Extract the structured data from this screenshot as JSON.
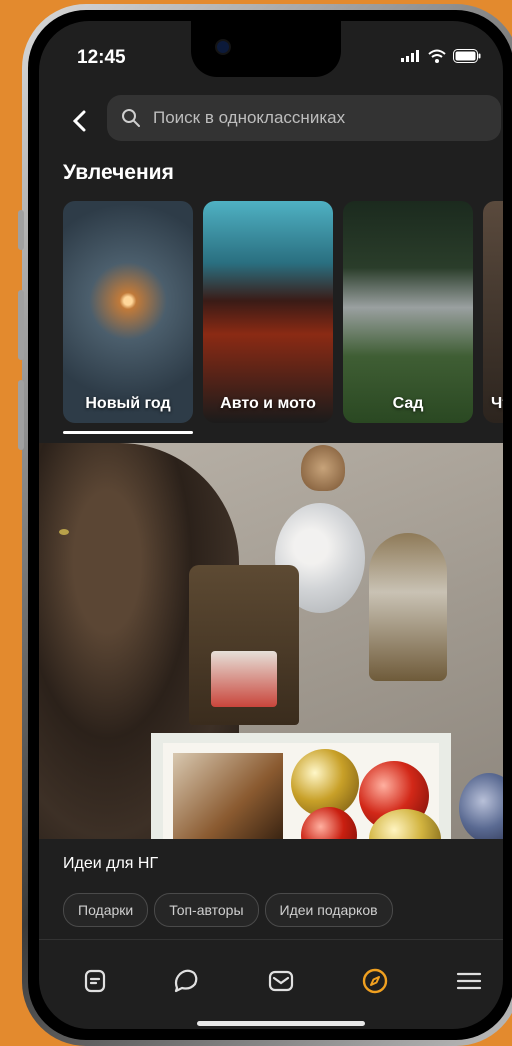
{
  "status": {
    "time": "12:45"
  },
  "search": {
    "placeholder": "Поиск в одноклассниках"
  },
  "section": {
    "title": "Увлечения"
  },
  "categories": [
    {
      "label": "Новый год",
      "selected": true
    },
    {
      "label": "Авто и мото",
      "selected": false
    },
    {
      "label": "Сад",
      "selected": false
    },
    {
      "label": "Чт",
      "selected": false
    }
  ],
  "post": {
    "title": "Идеи для НГ"
  },
  "chips": [
    "Подарки",
    "Топ-авторы",
    "Идеи подарков"
  ],
  "tabbar": {
    "items": [
      {
        "icon": "feed-icon"
      },
      {
        "icon": "chat-icon"
      },
      {
        "icon": "mail-icon"
      },
      {
        "icon": "compass-icon",
        "active": true
      },
      {
        "icon": "menu-icon"
      }
    ]
  },
  "colors": {
    "accent": "#f0a020",
    "background": "#1f1f1f",
    "outer": "#e38a2e"
  }
}
